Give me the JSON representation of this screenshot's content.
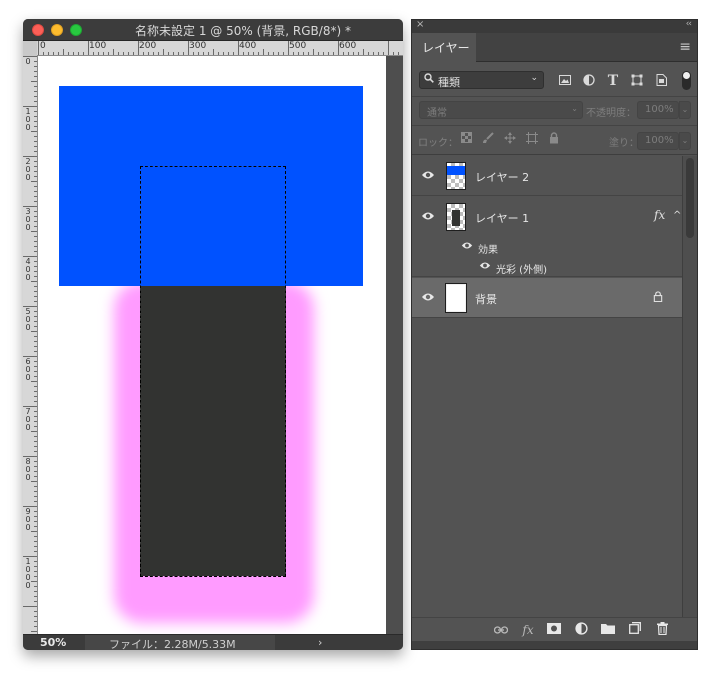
{
  "document": {
    "title": "名称未設定 1 @ 50% (背景, RGB/8*) *",
    "ruler_top_labels": [
      "0",
      "100",
      "200",
      "300",
      "400",
      "500",
      "600"
    ],
    "ruler_left_labels": [
      "0",
      "100",
      "200",
      "300",
      "400",
      "500",
      "600",
      "700",
      "800",
      "900",
      "1000"
    ],
    "zoom": "50%",
    "file_info": "ファイル：2.28M/5.33M",
    "status_arrow": "›",
    "colors": {
      "layer2_fill": "#0052ff",
      "layer1_fill": "#323331",
      "outer_glow": "#ff9bff",
      "canvas_bg": "#ffffff"
    }
  },
  "layers_panel": {
    "close": "×",
    "collapse": "‹‹",
    "tab_label": "レイヤー",
    "menu_icon": "≡",
    "filter": {
      "icon": "search-icon",
      "label": "種類",
      "chevron": "⌄"
    },
    "filter_icons": [
      "image-filter-icon",
      "adjustment-filter-icon",
      "type-filter-icon",
      "shape-filter-icon",
      "smart-object-filter-icon"
    ],
    "blend_mode": "通常",
    "opacity_label": "不透明度：",
    "opacity_value": "100%",
    "lock_label": "ロック：",
    "lock_icons": [
      "lock-transparent-icon",
      "lock-pixels-icon",
      "lock-position-icon",
      "lock-artboard-icon",
      "lock-all-icon"
    ],
    "fill_label": "塗り：",
    "fill_value": "100%",
    "layers": [
      {
        "name": "レイヤー 2",
        "visible": true,
        "thumb": "blue-top"
      },
      {
        "name": "レイヤー 1",
        "visible": true,
        "thumb": "dark-bar",
        "fx": "fx",
        "effects_label": "効果",
        "effects": [
          {
            "name": "光彩 (外側)"
          }
        ]
      },
      {
        "name": "背景",
        "visible": true,
        "thumb": "white",
        "locked": true,
        "selected": true
      }
    ],
    "bottom_icons": [
      "link-layers-icon",
      "fx-icon",
      "mask-icon",
      "adjustment-layer-icon",
      "folder-icon",
      "new-layer-icon",
      "trash-icon"
    ]
  }
}
